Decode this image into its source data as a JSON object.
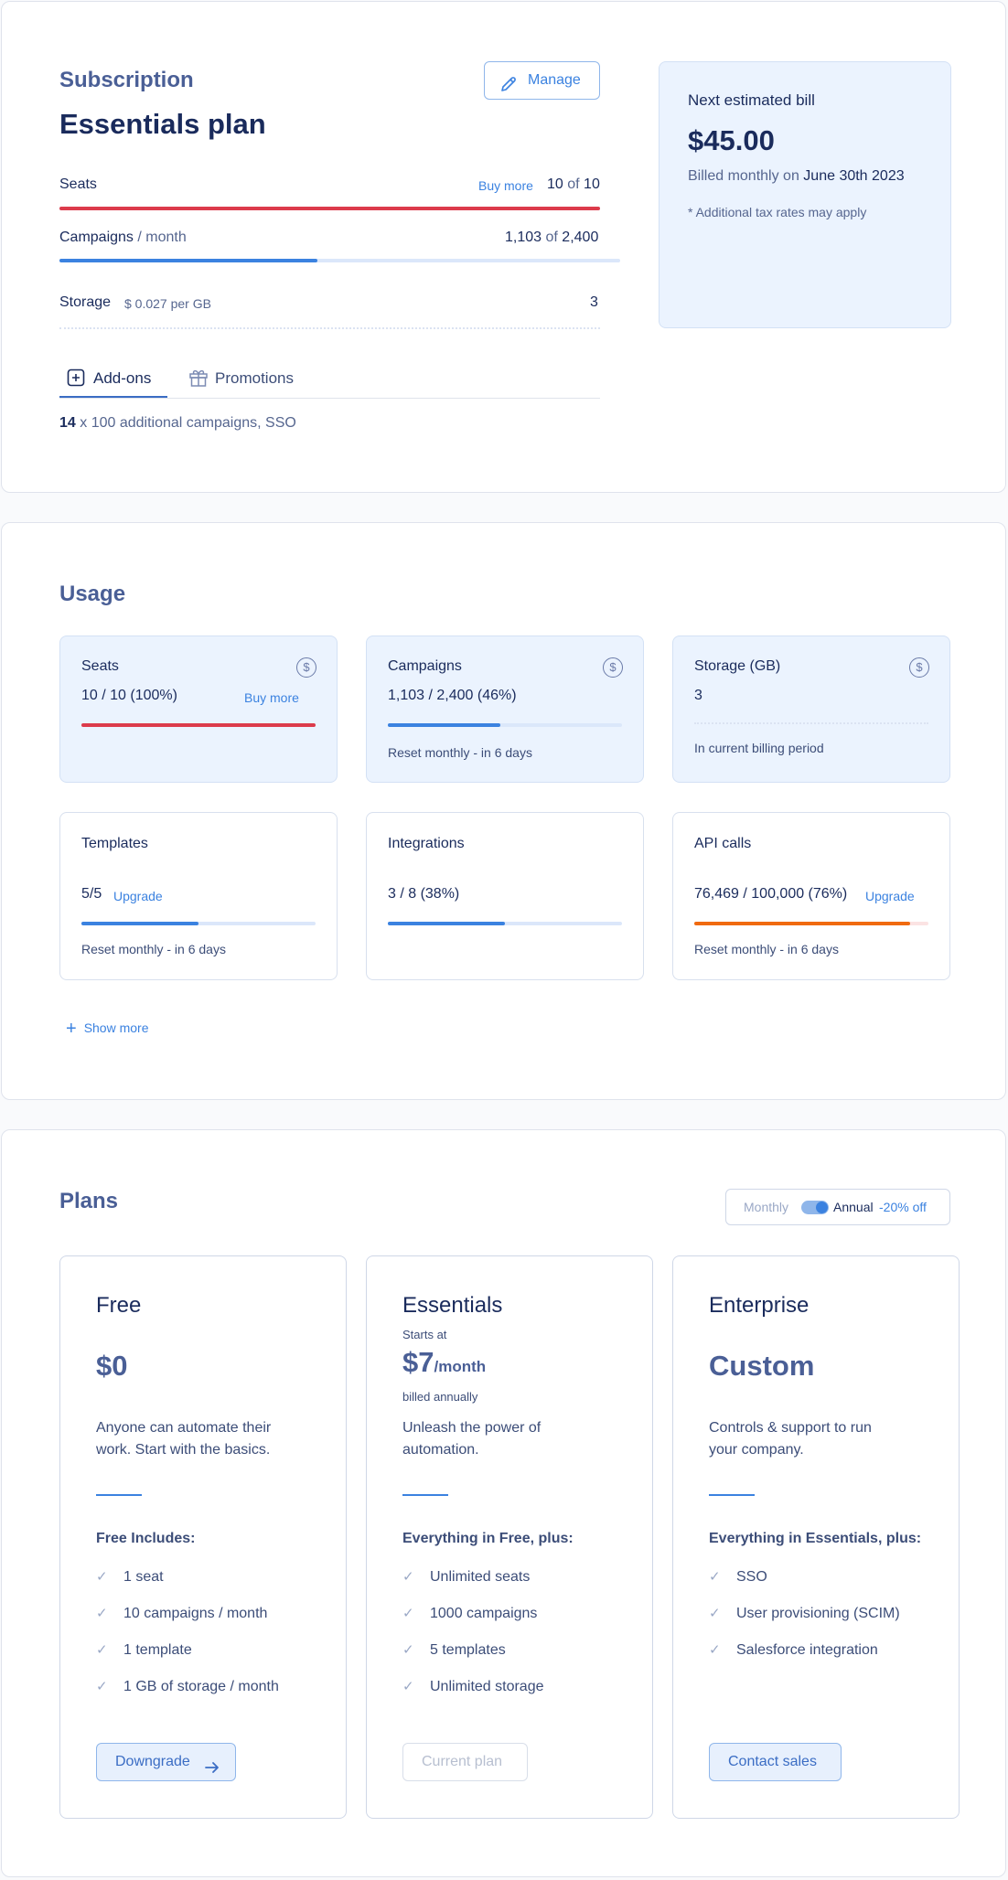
{
  "subscription": {
    "section_title": "Subscription",
    "plan_title": "Essentials plan",
    "manage_label": "Manage",
    "seats": {
      "label": "Seats",
      "buy_more": "Buy more",
      "used": "10",
      "of": "of",
      "total": "10",
      "fraction": 1.0,
      "color": "#dc3b4b"
    },
    "campaigns": {
      "label": "Campaigns",
      "per": " / month",
      "used": "1,103",
      "of": "of",
      "total": "2,400",
      "fraction": 0.46,
      "color": "#3b82e0"
    },
    "storage": {
      "label": "Storage",
      "rate": "$ 0.027 per GB",
      "value": "3"
    },
    "tabs": [
      {
        "label": "Add-ons"
      },
      {
        "label": "Promotions"
      }
    ],
    "addons": {
      "count": "14",
      "text": " x 100 additional campaigns, SSO"
    }
  },
  "bill": {
    "title": "Next estimated bill",
    "amount": "$45.00",
    "billed_prefix": "Billed monthly on ",
    "billed_date": "June 30th 2023",
    "note": "* Additional tax rates may apply"
  },
  "usage": {
    "section_title": "Usage",
    "cards": [
      {
        "title": "Seats",
        "value": "10 / 10 (100%)",
        "link": "Buy more",
        "fraction": 1.0,
        "color": "#dc3b4b",
        "icon": "dollar-circle-icon"
      },
      {
        "title": "Campaigns",
        "value": "1,103 / 2,400 (46%)",
        "note": "Reset monthly - in 6 days",
        "fraction": 0.48,
        "color": "#3b82e0",
        "icon": "dollar-circle-icon"
      },
      {
        "title": "Storage (GB)",
        "value": "3",
        "note": "In current billing period",
        "icon": "dollar-circle-icon"
      },
      {
        "title": "Templates",
        "value": "5/5",
        "link": "Upgrade",
        "note": "Reset monthly - in 6 days",
        "fraction": 0.5,
        "color": "#3b82e0"
      },
      {
        "title": "Integrations",
        "value": "3 / 8 (38%)",
        "fraction": 0.5,
        "color": "#3b82e0"
      },
      {
        "title": "API calls",
        "value": "76,469 / 100,000 (76%)",
        "link": "Upgrade",
        "note": "Reset monthly - in 6 days",
        "fraction": 0.92,
        "color": "#f06a10"
      }
    ],
    "show_more": "Show more"
  },
  "plans": {
    "section_title": "Plans",
    "toggle": {
      "monthly": "Monthly",
      "annual": "Annual",
      "discount": "-20% off",
      "selected": "Annual"
    },
    "cards": [
      {
        "name": "Free",
        "price": "$0",
        "desc": "Anyone can automate their work. Start with the basics.",
        "includes": "Free Includes:",
        "features": [
          "1 seat",
          "10 campaigns / month",
          "1 template",
          "1 GB of storage / month"
        ],
        "button": "Downgrade"
      },
      {
        "name": "Essentials",
        "starts_at": "Starts at",
        "price": "$7",
        "price_unit": "/month",
        "billing": "billed annually",
        "desc": "Unleash the power of automation.",
        "includes": "Everything in Free, plus:",
        "features": [
          "Unlimited seats",
          "1000 campaigns",
          "5 templates",
          "Unlimited storage"
        ],
        "button": "Current plan"
      },
      {
        "name": "Enterprise",
        "price": "Custom",
        "desc": "Controls & support to run your company.",
        "includes": "Everything in Essentials, plus:",
        "features": [
          "SSO",
          "User provisioning (SCIM)",
          "Salesforce integration"
        ],
        "button": "Contact sales"
      }
    ]
  }
}
